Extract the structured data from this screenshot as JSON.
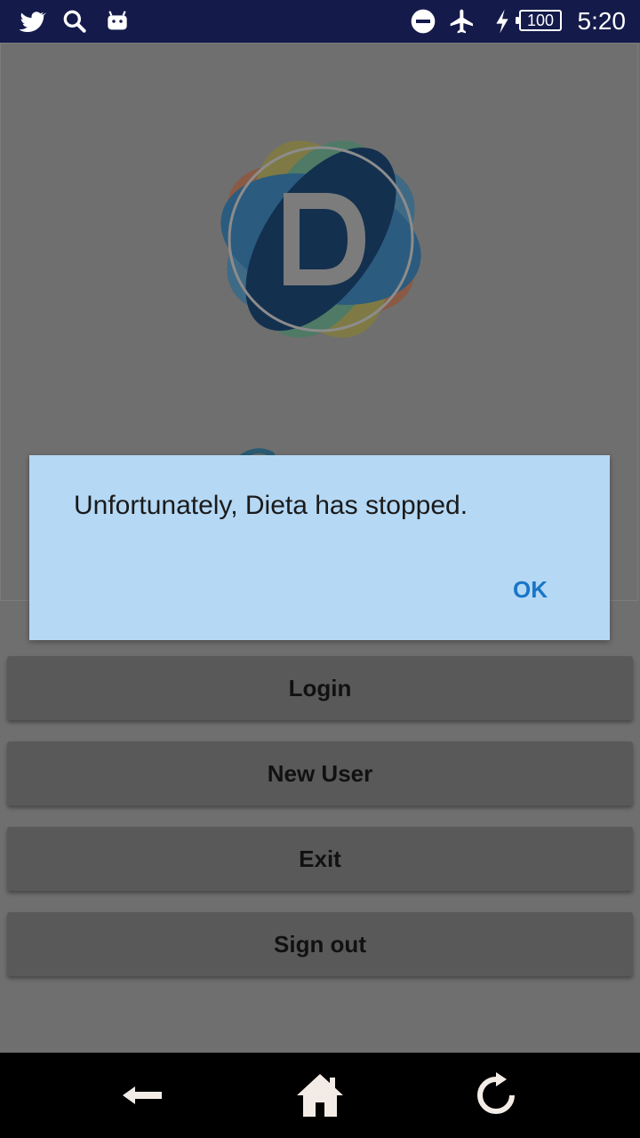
{
  "status_bar": {
    "time": "5:20",
    "battery": "100",
    "icons": [
      "twitter-icon",
      "search-icon",
      "android-icon",
      "dnd-icon",
      "airplane-icon",
      "charging-icon",
      "battery-icon"
    ]
  },
  "buttons": {
    "login": "Login",
    "new_user": "New User",
    "exit": "Exit",
    "sign_out": "Sign out"
  },
  "dialog": {
    "message": "Unfortunately, Dieta has stopped.",
    "ok_label": "OK"
  },
  "nav": {
    "icons": [
      "back-icon",
      "home-icon",
      "recent-icon"
    ]
  },
  "colors": {
    "status_bar": "#141a4a",
    "dialog_bg": "#b5d8f4",
    "ok_text": "#1976c8",
    "button_bg": "#595959"
  }
}
